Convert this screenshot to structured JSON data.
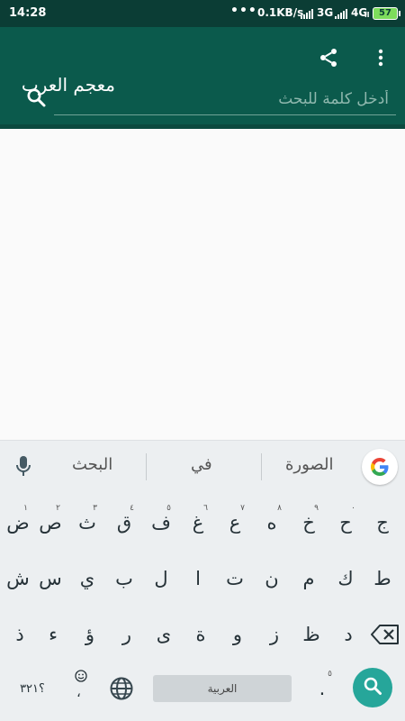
{
  "status_bar": {
    "time": "14:28",
    "dots": "•••",
    "speed": "0.1KB/s",
    "net1": "3G",
    "net2": "4G",
    "net2_sub": "ıl",
    "battery": "57"
  },
  "app_bar": {
    "title": "معجم العرب",
    "share_icon": "share-icon",
    "menu_icon": "more-vert-icon",
    "search_icon": "search-icon",
    "search_placeholder": "أدخل كلمة للبحث",
    "search_value": ""
  },
  "suggestions": {
    "items": [
      "الصورة",
      "في",
      "البحث"
    ],
    "google_icon": "google-icon",
    "mic_icon": "mic-icon"
  },
  "keyboard": {
    "row1": [
      {
        "char": "ج",
        "hint": ""
      },
      {
        "char": "ح",
        "hint": "٠"
      },
      {
        "char": "خ",
        "hint": "٩"
      },
      {
        "char": "ه",
        "hint": "٨"
      },
      {
        "char": "ع",
        "hint": "٧"
      },
      {
        "char": "غ",
        "hint": "٦"
      },
      {
        "char": "ف",
        "hint": "٥"
      },
      {
        "char": "ق",
        "hint": "٤"
      },
      {
        "char": "ث",
        "hint": "٣"
      },
      {
        "char": "ص",
        "hint": "٢"
      },
      {
        "char": "ض",
        "hint": "١"
      }
    ],
    "row2": [
      "ط",
      "ك",
      "م",
      "ن",
      "ت",
      "ا",
      "ل",
      "ب",
      "ي",
      "س",
      "ش"
    ],
    "row3": [
      "د",
      "ظ",
      "ز",
      "و",
      "ة",
      "ى",
      "ر",
      "ؤ",
      "ء",
      "ذ"
    ],
    "bottom": {
      "symbols": "؟٣٢١",
      "comma": "،",
      "emoji_icon": "emoji-icon",
      "globe_icon": "globe-icon",
      "space_label": "العربية",
      "period": ".",
      "period_hint": "٥",
      "enter_icon": "search-icon",
      "backspace_icon": "backspace-icon"
    }
  },
  "colors": {
    "status_bar": "#0b3d35",
    "app_bar": "#0b5a4c",
    "accent": "#26a69a",
    "keyboard_bg": "#eceff1"
  }
}
